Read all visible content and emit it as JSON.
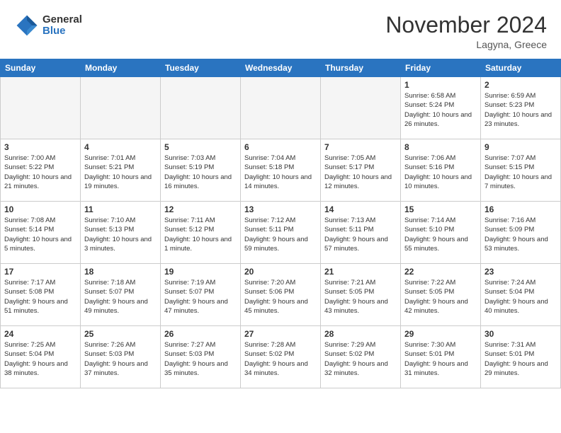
{
  "header": {
    "logo_general": "General",
    "logo_blue": "Blue",
    "month_title": "November 2024",
    "location": "Lagyna, Greece"
  },
  "weekdays": [
    "Sunday",
    "Monday",
    "Tuesday",
    "Wednesday",
    "Thursday",
    "Friday",
    "Saturday"
  ],
  "weeks": [
    [
      {
        "day": "",
        "info": ""
      },
      {
        "day": "",
        "info": ""
      },
      {
        "day": "",
        "info": ""
      },
      {
        "day": "",
        "info": ""
      },
      {
        "day": "",
        "info": ""
      },
      {
        "day": "1",
        "info": "Sunrise: 6:58 AM\nSunset: 5:24 PM\nDaylight: 10 hours and 26 minutes."
      },
      {
        "day": "2",
        "info": "Sunrise: 6:59 AM\nSunset: 5:23 PM\nDaylight: 10 hours and 23 minutes."
      }
    ],
    [
      {
        "day": "3",
        "info": "Sunrise: 7:00 AM\nSunset: 5:22 PM\nDaylight: 10 hours and 21 minutes."
      },
      {
        "day": "4",
        "info": "Sunrise: 7:01 AM\nSunset: 5:21 PM\nDaylight: 10 hours and 19 minutes."
      },
      {
        "day": "5",
        "info": "Sunrise: 7:03 AM\nSunset: 5:19 PM\nDaylight: 10 hours and 16 minutes."
      },
      {
        "day": "6",
        "info": "Sunrise: 7:04 AM\nSunset: 5:18 PM\nDaylight: 10 hours and 14 minutes."
      },
      {
        "day": "7",
        "info": "Sunrise: 7:05 AM\nSunset: 5:17 PM\nDaylight: 10 hours and 12 minutes."
      },
      {
        "day": "8",
        "info": "Sunrise: 7:06 AM\nSunset: 5:16 PM\nDaylight: 10 hours and 10 minutes."
      },
      {
        "day": "9",
        "info": "Sunrise: 7:07 AM\nSunset: 5:15 PM\nDaylight: 10 hours and 7 minutes."
      }
    ],
    [
      {
        "day": "10",
        "info": "Sunrise: 7:08 AM\nSunset: 5:14 PM\nDaylight: 10 hours and 5 minutes."
      },
      {
        "day": "11",
        "info": "Sunrise: 7:10 AM\nSunset: 5:13 PM\nDaylight: 10 hours and 3 minutes."
      },
      {
        "day": "12",
        "info": "Sunrise: 7:11 AM\nSunset: 5:12 PM\nDaylight: 10 hours and 1 minute."
      },
      {
        "day": "13",
        "info": "Sunrise: 7:12 AM\nSunset: 5:11 PM\nDaylight: 9 hours and 59 minutes."
      },
      {
        "day": "14",
        "info": "Sunrise: 7:13 AM\nSunset: 5:11 PM\nDaylight: 9 hours and 57 minutes."
      },
      {
        "day": "15",
        "info": "Sunrise: 7:14 AM\nSunset: 5:10 PM\nDaylight: 9 hours and 55 minutes."
      },
      {
        "day": "16",
        "info": "Sunrise: 7:16 AM\nSunset: 5:09 PM\nDaylight: 9 hours and 53 minutes."
      }
    ],
    [
      {
        "day": "17",
        "info": "Sunrise: 7:17 AM\nSunset: 5:08 PM\nDaylight: 9 hours and 51 minutes."
      },
      {
        "day": "18",
        "info": "Sunrise: 7:18 AM\nSunset: 5:07 PM\nDaylight: 9 hours and 49 minutes."
      },
      {
        "day": "19",
        "info": "Sunrise: 7:19 AM\nSunset: 5:07 PM\nDaylight: 9 hours and 47 minutes."
      },
      {
        "day": "20",
        "info": "Sunrise: 7:20 AM\nSunset: 5:06 PM\nDaylight: 9 hours and 45 minutes."
      },
      {
        "day": "21",
        "info": "Sunrise: 7:21 AM\nSunset: 5:05 PM\nDaylight: 9 hours and 43 minutes."
      },
      {
        "day": "22",
        "info": "Sunrise: 7:22 AM\nSunset: 5:05 PM\nDaylight: 9 hours and 42 minutes."
      },
      {
        "day": "23",
        "info": "Sunrise: 7:24 AM\nSunset: 5:04 PM\nDaylight: 9 hours and 40 minutes."
      }
    ],
    [
      {
        "day": "24",
        "info": "Sunrise: 7:25 AM\nSunset: 5:04 PM\nDaylight: 9 hours and 38 minutes."
      },
      {
        "day": "25",
        "info": "Sunrise: 7:26 AM\nSunset: 5:03 PM\nDaylight: 9 hours and 37 minutes."
      },
      {
        "day": "26",
        "info": "Sunrise: 7:27 AM\nSunset: 5:03 PM\nDaylight: 9 hours and 35 minutes."
      },
      {
        "day": "27",
        "info": "Sunrise: 7:28 AM\nSunset: 5:02 PM\nDaylight: 9 hours and 34 minutes."
      },
      {
        "day": "28",
        "info": "Sunrise: 7:29 AM\nSunset: 5:02 PM\nDaylight: 9 hours and 32 minutes."
      },
      {
        "day": "29",
        "info": "Sunrise: 7:30 AM\nSunset: 5:01 PM\nDaylight: 9 hours and 31 minutes."
      },
      {
        "day": "30",
        "info": "Sunrise: 7:31 AM\nSunset: 5:01 PM\nDaylight: 9 hours and 29 minutes."
      }
    ]
  ]
}
